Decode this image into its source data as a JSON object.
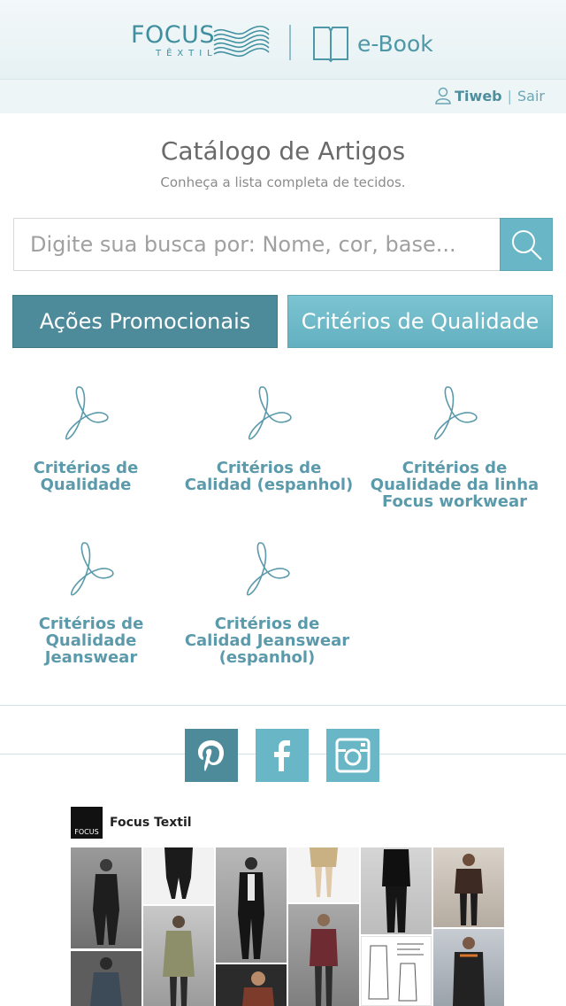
{
  "header": {
    "brand": "FOCUS",
    "brand_sub": "TÊXTIL",
    "ebook_label": "e-Book"
  },
  "user": {
    "name": "Tiweb",
    "separator": "|",
    "logout": "Sair"
  },
  "catalog": {
    "title": "Catálogo de Artigos",
    "subtitle": "Conheça a lista completa de tecidos."
  },
  "search": {
    "placeholder": "Digite sua busca por: Nome, cor, base..."
  },
  "buttons": {
    "promo": "Ações Promocionais",
    "quality": "Critérios de Qualidade"
  },
  "documents": [
    {
      "line1": "Critérios de",
      "line2": "Qualidade",
      "line3": ""
    },
    {
      "line1": "Critérios de",
      "line2": "Calidad (espanhol)",
      "line3": ""
    },
    {
      "line1": "Critérios de",
      "line2": "Qualidade da linha",
      "line3": "Focus workwear"
    },
    {
      "line1": "Critérios de",
      "line2": "Qualidade",
      "line3": "Jeanswear"
    },
    {
      "line1": "Critérios de",
      "line2": "Calidad Jeanswear",
      "line3": "(espanhol)"
    }
  ],
  "social": [
    "pinterest-icon",
    "facebook-icon",
    "instagram-icon"
  ],
  "feed": {
    "account_name": "Focus Textil",
    "avatar_text": "FOCUS"
  },
  "colors": {
    "accent": "#69b7c6",
    "accent_dark": "#4d8b9b",
    "link": "#5b9aab"
  }
}
